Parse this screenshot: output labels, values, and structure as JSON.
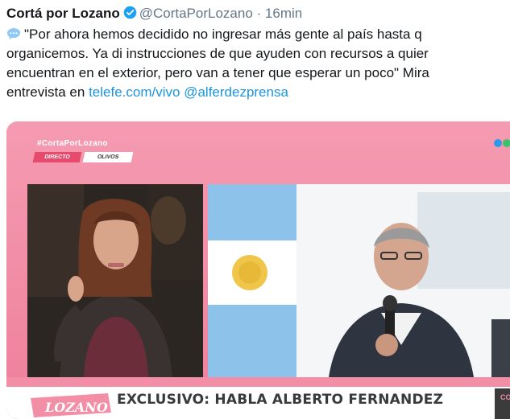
{
  "tweet": {
    "author_name": "Cortá por Lozano",
    "handle": "@CortaPorLozano",
    "separator": "·",
    "time": "16min",
    "text_lines": [
      "\"Por ahora hemos decidido no ingresar más gente al país hasta q",
      "organicemos. Ya di instrucciones de que ayuden con recursos a quier",
      "encuentran en el exterior, pero van a tener que esperar un poco\" Mira"
    ],
    "last_line_prefix": "entrevista en",
    "link_1": "telefe.com/vivo",
    "link_2": "@alferdezprensa",
    "icons": {
      "verified": "verified-badge-icon",
      "speech": "speech-bubble-icon"
    },
    "colors": {
      "link": "#1b95e0",
      "verified": "#1da1f2",
      "muted": "#657786"
    }
  },
  "video": {
    "hashtag": "#CortaPorLozano",
    "live_tag": "DIRECTO",
    "location_tag": "OLIVOS",
    "headline": "EXCLUSIVO: HABLA ALBERTO FERNANDEZ",
    "corner_text": "COR",
    "colors": {
      "pink": "#f28ea6",
      "tag": "#e84a6d"
    }
  }
}
